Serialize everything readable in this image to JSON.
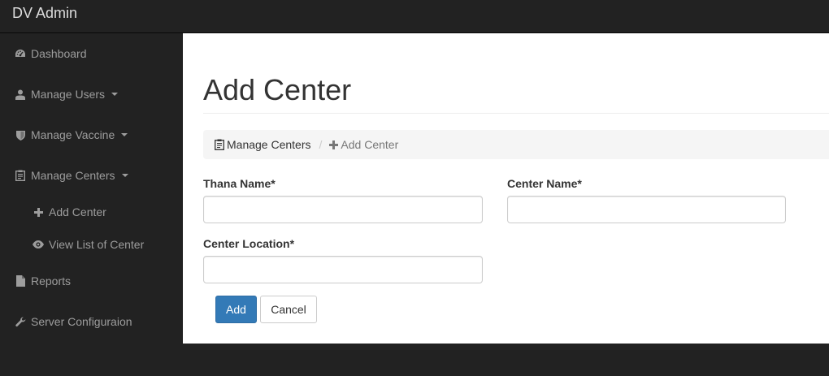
{
  "app": {
    "brand": "DV Admin"
  },
  "sidebar": {
    "items": [
      {
        "label": "Dashboard",
        "icon": "dashboard-icon"
      },
      {
        "label": "Manage Users",
        "icon": "user-icon"
      },
      {
        "label": "Manage Vaccine",
        "icon": "shield-icon"
      },
      {
        "label": "Manage Centers",
        "icon": "clipboard-icon"
      },
      {
        "label": "Reports",
        "icon": "file-icon"
      },
      {
        "label": "Server Configuraion",
        "icon": "wrench-icon"
      }
    ],
    "subitems": [
      {
        "label": "Add Center",
        "icon": "plus-icon"
      },
      {
        "label": "View List of Center",
        "icon": "eye-icon"
      }
    ]
  },
  "page": {
    "title": "Add Center",
    "breadcrumb": [
      {
        "label": "Manage Centers",
        "icon": "clipboard-icon"
      },
      {
        "label": "Add Center",
        "icon": "plus-icon"
      }
    ],
    "form": {
      "thana_label": "Thana Name*",
      "thana_value": "",
      "center_name_label": "Center Name*",
      "center_name_value": "",
      "center_location_label": "Center Location*",
      "center_location_value": "",
      "add_button": "Add",
      "cancel_button": "Cancel"
    }
  },
  "colors": {
    "navbar": "#222222",
    "primary": "#337ab7",
    "breadcrumb_bg": "#f5f5f5"
  }
}
